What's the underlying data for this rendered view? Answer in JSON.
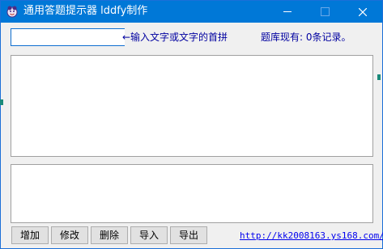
{
  "window": {
    "title": "通用答题提示器  lddfy制作",
    "icon": "app-logo-icon",
    "controls": {
      "minimize": "minimize-icon",
      "maximize": "maximize-icon",
      "close": "×"
    }
  },
  "search": {
    "value": "",
    "hint": "←输入文字或文字的首拼",
    "count_text": "题库现有: 0条记录。"
  },
  "buttons": {
    "add": "增加",
    "edit": "修改",
    "delete": "删除",
    "import": "导入",
    "export": "导出"
  },
  "footer": {
    "link": "http://kk2008163.ys168.com/"
  },
  "colors": {
    "titlebar": "#0078d7",
    "hint_text": "#0000a0",
    "link": "#0000ee"
  }
}
